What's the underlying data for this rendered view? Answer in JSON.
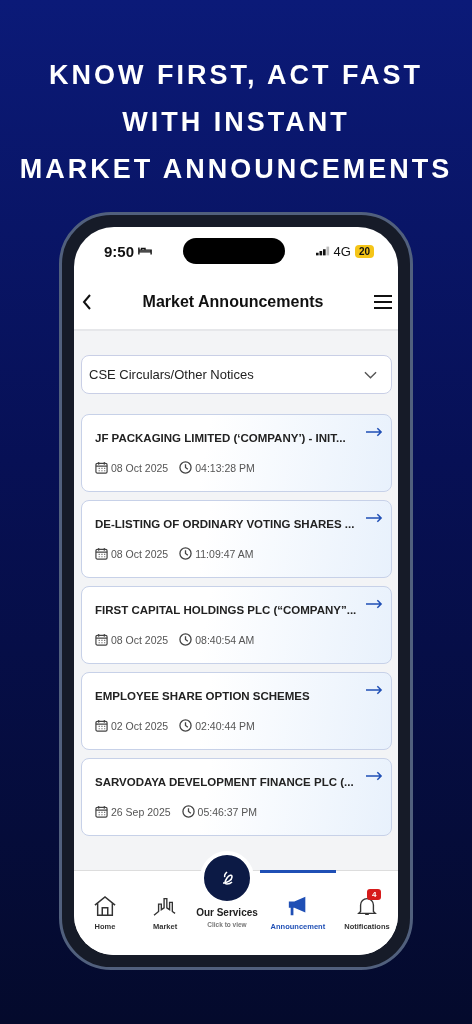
{
  "headline": [
    "KNOW FIRST, ACT FAST",
    "WITH INSTANT",
    "MARKET ANNOUNCEMENTS"
  ],
  "status_bar": {
    "time": "9:50",
    "network": "4G",
    "battery": "20"
  },
  "header": {
    "title": "Market Announcements"
  },
  "filter": {
    "value": "CSE Circulars/Other Notices"
  },
  "announcements": [
    {
      "title": "JF PACKAGING LIMITED (‘COMPANY’) - INIT...",
      "date": "08 Oct 2025",
      "time": "04:13:28 PM"
    },
    {
      "title": "DE-LISTING OF ORDINARY VOTING SHARES ...",
      "date": "08 Oct 2025",
      "time": "11:09:47 AM"
    },
    {
      "title": "FIRST CAPITAL HOLDINGS PLC (“COMPANY”...",
      "date": "08 Oct 2025",
      "time": "08:40:54 AM"
    },
    {
      "title": "EMPLOYEE SHARE OPTION SCHEMES",
      "date": "02 Oct 2025",
      "time": "02:40:44 PM"
    },
    {
      "title": "SARVODAYA DEVELOPMENT FINANCE PLC (...",
      "date": "26 Sep 2025",
      "time": "05:46:37 PM"
    }
  ],
  "bottom_nav": [
    {
      "kind": "home",
      "label": "Home",
      "selected": false
    },
    {
      "kind": "market",
      "label": "Market",
      "selected": false
    },
    {
      "kind": "services",
      "label": "Our Services",
      "sublabel": "Click to view",
      "selected": false
    },
    {
      "kind": "announcement",
      "label": "Announcement",
      "selected": true
    },
    {
      "kind": "notifications",
      "label": "Notifications",
      "badge": "4",
      "selected": false
    }
  ]
}
